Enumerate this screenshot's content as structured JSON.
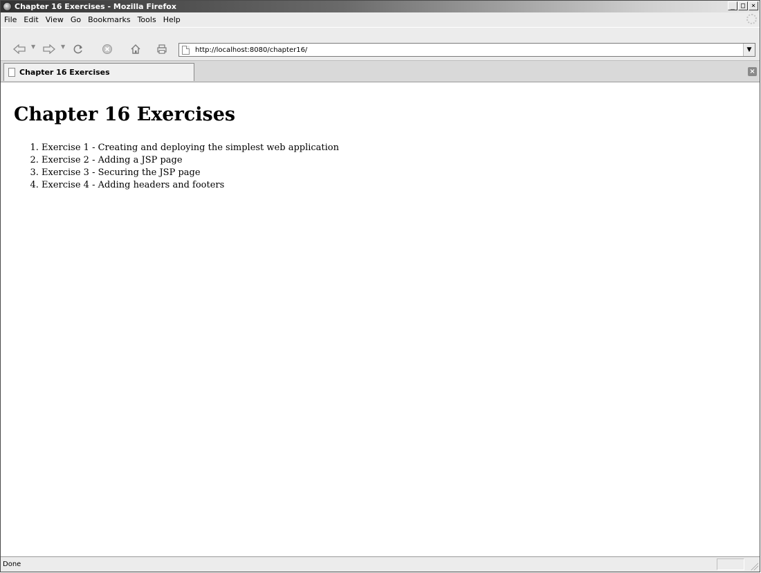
{
  "window": {
    "title": "Chapter 16 Exercises - Mozilla Firefox",
    "controls": {
      "minimize": "_",
      "maximize": "□",
      "close": "×"
    }
  },
  "menu": {
    "items": [
      "File",
      "Edit",
      "View",
      "Go",
      "Bookmarks",
      "Tools",
      "Help"
    ]
  },
  "navigation": {
    "url": "http://localhost:8080/chapter16/"
  },
  "tabs": [
    {
      "label": "Chapter 16 Exercises",
      "active": true
    }
  ],
  "page": {
    "heading": "Chapter 16 Exercises",
    "exercises": [
      "Exercise 1 - Creating and deploying the simplest web application",
      "Exercise 2 - Adding a JSP page",
      "Exercise 3 - Securing the JSP page",
      "Exercise 4 - Adding headers and footers"
    ]
  },
  "status": {
    "text": "Done"
  },
  "icons": {
    "app": "firefox-icon",
    "back": "back-arrow-icon",
    "forward": "forward-arrow-icon",
    "reload": "reload-icon",
    "stop": "stop-icon",
    "home": "home-icon",
    "print": "print-icon",
    "page": "page-icon",
    "tab_close": "close-tab-icon",
    "throbber": "throbber-icon"
  }
}
